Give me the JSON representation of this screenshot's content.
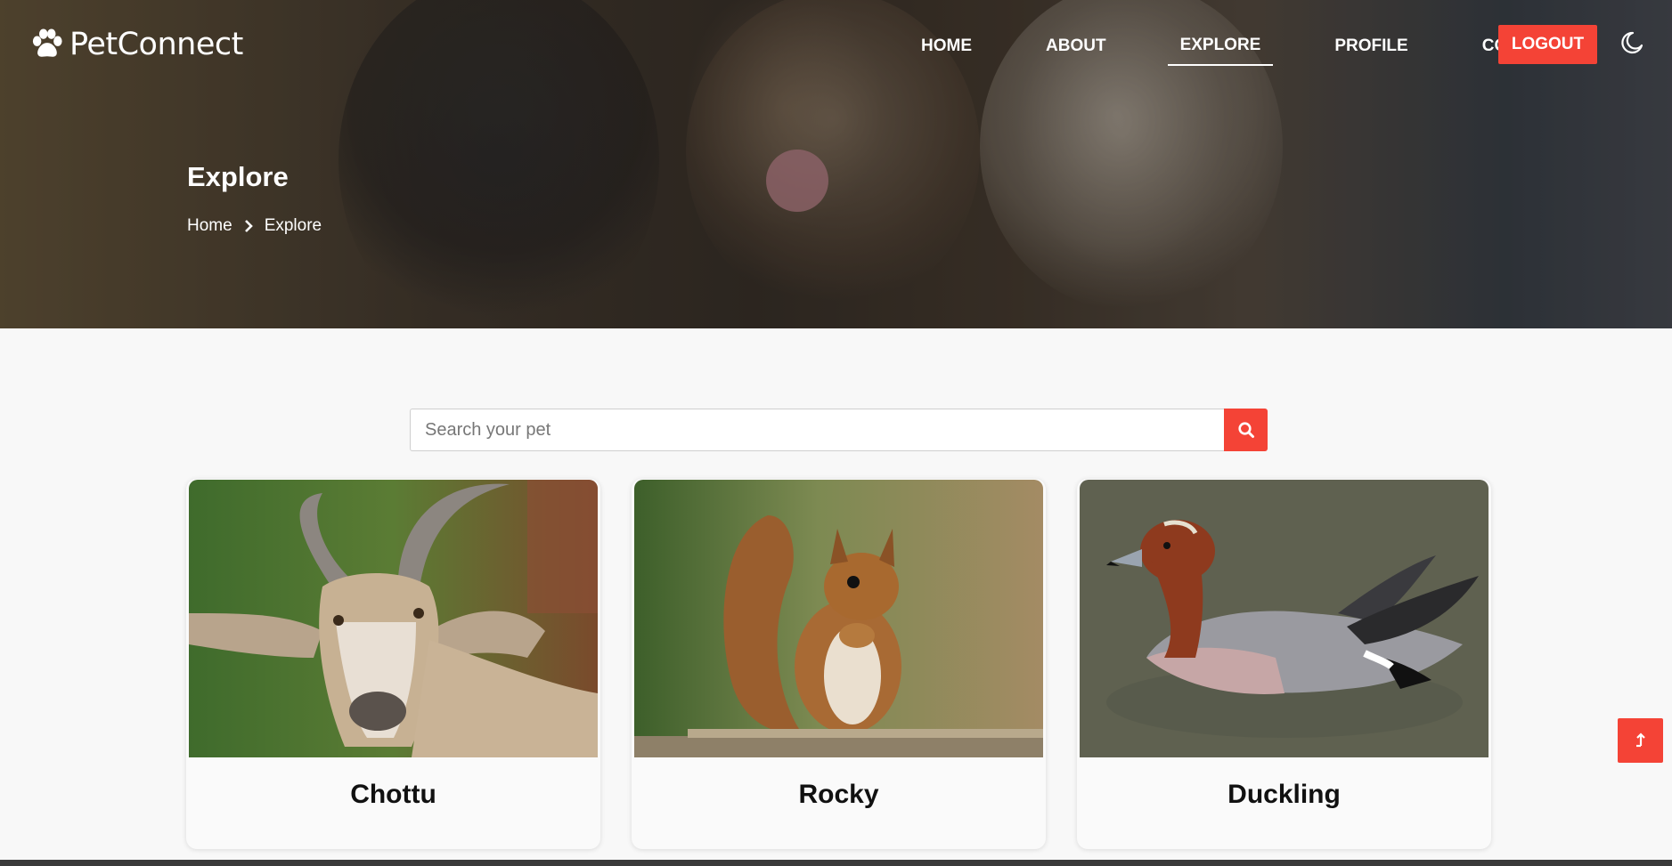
{
  "brand": {
    "name": "PetConnect",
    "icon": "paw-icon"
  },
  "nav": {
    "items": [
      {
        "label": "HOME",
        "active": false
      },
      {
        "label": "ABOUT",
        "active": false
      },
      {
        "label": "EXPLORE",
        "active": true
      },
      {
        "label": "PROFILE",
        "active": false
      },
      {
        "label": "CONTACT",
        "active": false
      }
    ],
    "logout_label": "LOGOUT",
    "theme_toggle_icon": "moon-icon"
  },
  "hero": {
    "title": "Explore",
    "breadcrumb": [
      "Home",
      "Explore"
    ]
  },
  "search": {
    "placeholder": "Search your pet",
    "value": "",
    "button_icon": "search-icon"
  },
  "pets": [
    {
      "name": "Chottu",
      "image": "goat"
    },
    {
      "name": "Rocky",
      "image": "squirrel"
    },
    {
      "name": "Duckling",
      "image": "duck"
    }
  ],
  "scroll_top_icon": "arrow-up-icon",
  "colors": {
    "accent": "#f44336",
    "text": "#111111",
    "background": "#f8f8f8"
  }
}
